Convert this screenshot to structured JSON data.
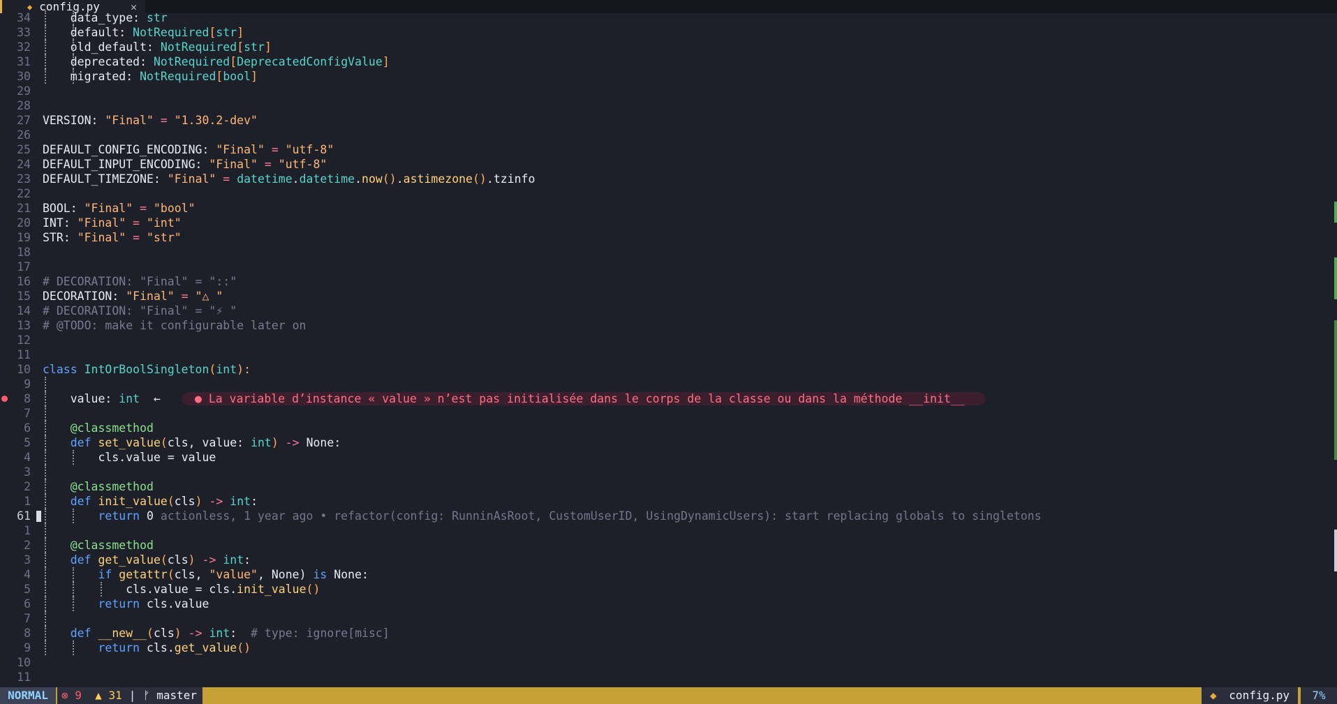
{
  "tab": {
    "filename": "config.py",
    "file_icon": "python-file-icon",
    "close_glyph": "✕"
  },
  "lines": [
    {
      "ln": "34",
      "code": [
        [
          "    ",
          "n"
        ],
        [
          "data_type",
          "n"
        ],
        [
          ": ",
          "n"
        ],
        [
          "str",
          "t"
        ]
      ],
      "guides": 2
    },
    {
      "ln": "33",
      "code": [
        [
          "    ",
          "n"
        ],
        [
          "default",
          "n"
        ],
        [
          ": ",
          "n"
        ],
        [
          "NotRequired",
          "t"
        ],
        [
          "[",
          "br"
        ],
        [
          "str",
          "t"
        ],
        [
          "]",
          "br"
        ]
      ],
      "guides": 2
    },
    {
      "ln": "32",
      "code": [
        [
          "    ",
          "n"
        ],
        [
          "old_default",
          "n"
        ],
        [
          ": ",
          "n"
        ],
        [
          "NotRequired",
          "t"
        ],
        [
          "[",
          "br"
        ],
        [
          "str",
          "t"
        ],
        [
          "]",
          "br"
        ]
      ],
      "guides": 2
    },
    {
      "ln": "31",
      "code": [
        [
          "    ",
          "n"
        ],
        [
          "deprecated",
          "n"
        ],
        [
          ": ",
          "n"
        ],
        [
          "NotRequired",
          "t"
        ],
        [
          "[",
          "br"
        ],
        [
          "DeprecatedConfigValue",
          "t"
        ],
        [
          "]",
          "br"
        ]
      ],
      "guides": 2
    },
    {
      "ln": "30",
      "code": [
        [
          "    ",
          "n"
        ],
        [
          "migrated",
          "n"
        ],
        [
          ": ",
          "n"
        ],
        [
          "NotRequired",
          "t"
        ],
        [
          "[",
          "br"
        ],
        [
          "bool",
          "t"
        ],
        [
          "]",
          "br"
        ]
      ],
      "guides": 2
    },
    {
      "ln": "29",
      "code": []
    },
    {
      "ln": "28",
      "code": []
    },
    {
      "ln": "27",
      "code": [
        [
          "VERSION",
          "n"
        ],
        [
          ": ",
          "n"
        ],
        [
          "\"Final\"",
          "s"
        ],
        [
          " = ",
          "op"
        ],
        [
          "\"1.30.2-dev\"",
          "s"
        ]
      ]
    },
    {
      "ln": "26",
      "code": []
    },
    {
      "ln": "25",
      "code": [
        [
          "DEFAULT_CONFIG_ENCODING",
          "n"
        ],
        [
          ": ",
          "n"
        ],
        [
          "\"Final\"",
          "s"
        ],
        [
          " = ",
          "op"
        ],
        [
          "\"utf-8\"",
          "s"
        ]
      ]
    },
    {
      "ln": "24",
      "code": [
        [
          "DEFAULT_INPUT_ENCODING",
          "n"
        ],
        [
          ": ",
          "n"
        ],
        [
          "\"Final\"",
          "s"
        ],
        [
          " = ",
          "op"
        ],
        [
          "\"utf-8\"",
          "s"
        ]
      ]
    },
    {
      "ln": "23",
      "code": [
        [
          "DEFAULT_TIMEZONE",
          "n"
        ],
        [
          ": ",
          "n"
        ],
        [
          "\"Final\"",
          "s"
        ],
        [
          " = ",
          "op"
        ],
        [
          "datetime",
          "t"
        ],
        [
          ".",
          "n"
        ],
        [
          "datetime",
          "t"
        ],
        [
          ".",
          "n"
        ],
        [
          "now",
          "f"
        ],
        [
          "()",
          "br"
        ],
        [
          ".",
          "n"
        ],
        [
          "astimezone",
          "f"
        ],
        [
          "()",
          "br"
        ],
        [
          ".",
          "n"
        ],
        [
          "tzinfo",
          "n"
        ]
      ]
    },
    {
      "ln": "22",
      "code": []
    },
    {
      "ln": "21",
      "code": [
        [
          "BOOL",
          "n"
        ],
        [
          ": ",
          "n"
        ],
        [
          "\"Final\"",
          "s"
        ],
        [
          " = ",
          "op"
        ],
        [
          "\"bool\"",
          "s"
        ]
      ]
    },
    {
      "ln": "20",
      "code": [
        [
          "INT",
          "n"
        ],
        [
          ": ",
          "n"
        ],
        [
          "\"Final\"",
          "s"
        ],
        [
          " = ",
          "op"
        ],
        [
          "\"int\"",
          "s"
        ]
      ]
    },
    {
      "ln": "19",
      "code": [
        [
          "STR",
          "n"
        ],
        [
          ": ",
          "n"
        ],
        [
          "\"Final\"",
          "s"
        ],
        [
          " = ",
          "op"
        ],
        [
          "\"str\"",
          "s"
        ]
      ]
    },
    {
      "ln": "18",
      "code": []
    },
    {
      "ln": "17",
      "code": []
    },
    {
      "ln": "16",
      "code": [
        [
          "# DECORATION: \"Final\" = \"::\"",
          "c"
        ]
      ]
    },
    {
      "ln": "15",
      "code": [
        [
          "DECORATION",
          "n"
        ],
        [
          ": ",
          "n"
        ],
        [
          "\"Final\"",
          "s"
        ],
        [
          " = ",
          "op"
        ],
        [
          "\"△ \"",
          "s"
        ]
      ]
    },
    {
      "ln": "14",
      "code": [
        [
          "# DECORATION: \"Final\" = \"⚡ \"",
          "c"
        ]
      ]
    },
    {
      "ln": "13",
      "code": [
        [
          "# @TODO: make it configurable later on",
          "c"
        ]
      ]
    },
    {
      "ln": "12",
      "code": []
    },
    {
      "ln": "11",
      "code": []
    },
    {
      "ln": "10",
      "code": [
        [
          "class ",
          "k"
        ],
        [
          "IntOrBoolSingleton",
          "t"
        ],
        [
          "(",
          "br"
        ],
        [
          "int",
          "t"
        ],
        [
          "):",
          "br"
        ]
      ]
    },
    {
      "ln": "9",
      "code": [],
      "guides": 1
    },
    {
      "ln": "8",
      "code": [
        [
          "    ",
          "n"
        ],
        [
          "value",
          "n"
        ],
        [
          ": ",
          "n"
        ],
        [
          "int",
          "t"
        ],
        [
          "  ←",
          "n"
        ]
      ],
      "guides": 1,
      "error": true,
      "diagnostic": "● La variable d’instance « value » n’est pas initialisée dans le corps de la classe ou dans la méthode __init__"
    },
    {
      "ln": "7",
      "code": [],
      "guides": 1
    },
    {
      "ln": "6",
      "code": [
        [
          "    ",
          "n"
        ],
        [
          "@classmethod",
          "d"
        ]
      ],
      "guides": 1
    },
    {
      "ln": "5",
      "code": [
        [
          "    ",
          "n"
        ],
        [
          "def ",
          "k"
        ],
        [
          "set_value",
          "f"
        ],
        [
          "(",
          "br"
        ],
        [
          "cls, value: ",
          "n"
        ],
        [
          "int",
          "t"
        ],
        [
          ") ",
          "br"
        ],
        [
          "-> ",
          "op"
        ],
        [
          "None",
          "n"
        ],
        [
          ":",
          "n"
        ]
      ],
      "guides": 1
    },
    {
      "ln": "4",
      "code": [
        [
          "        ",
          "n"
        ],
        [
          "cls.value = value",
          "n"
        ]
      ],
      "guides": 2
    },
    {
      "ln": "3",
      "code": [],
      "guides": 1
    },
    {
      "ln": "2",
      "code": [
        [
          "    ",
          "n"
        ],
        [
          "@classmethod",
          "d"
        ]
      ],
      "guides": 1
    },
    {
      "ln": "1",
      "code": [
        [
          "    ",
          "n"
        ],
        [
          "def ",
          "k"
        ],
        [
          "init_value",
          "f"
        ],
        [
          "(",
          "br"
        ],
        [
          "cls",
          "n"
        ],
        [
          ") ",
          "br"
        ],
        [
          "-> ",
          "op"
        ],
        [
          "int",
          "t"
        ],
        [
          ":",
          "n"
        ]
      ],
      "guides": 1
    },
    {
      "ln": "61",
      "current": true,
      "code": [
        [
          "        ",
          "n"
        ],
        [
          "return ",
          "k"
        ],
        [
          "0",
          "n"
        ],
        [
          " actionless, 1 year ago • refactor(config: RunninAsRoot, CustomUserID, UsingDynamicUsers): start replacing globals to singletons",
          "blame"
        ]
      ],
      "guides": 2
    },
    {
      "ln": "1",
      "code": [],
      "guides": 1
    },
    {
      "ln": "2",
      "code": [
        [
          "    ",
          "n"
        ],
        [
          "@classmethod",
          "d"
        ]
      ],
      "guides": 1
    },
    {
      "ln": "3",
      "code": [
        [
          "    ",
          "n"
        ],
        [
          "def ",
          "k"
        ],
        [
          "get_value",
          "f"
        ],
        [
          "(",
          "br"
        ],
        [
          "cls",
          "n"
        ],
        [
          ") ",
          "br"
        ],
        [
          "-> ",
          "op"
        ],
        [
          "int",
          "t"
        ],
        [
          ":",
          "n"
        ]
      ],
      "guides": 1
    },
    {
      "ln": "4",
      "code": [
        [
          "        ",
          "n"
        ],
        [
          "if ",
          "k"
        ],
        [
          "getattr",
          "f"
        ],
        [
          "(",
          "br"
        ],
        [
          "cls, ",
          "n"
        ],
        [
          "\"value\"",
          "s"
        ],
        [
          ", None) ",
          "n"
        ],
        [
          "is ",
          "k"
        ],
        [
          "None",
          "n"
        ],
        [
          ":",
          "n"
        ]
      ],
      "guides": 2
    },
    {
      "ln": "5",
      "code": [
        [
          "            ",
          "n"
        ],
        [
          "cls.value = cls.",
          "n"
        ],
        [
          "init_value",
          "f"
        ],
        [
          "()",
          "br"
        ]
      ],
      "guides": 3
    },
    {
      "ln": "6",
      "code": [
        [
          "        ",
          "n"
        ],
        [
          "return ",
          "k"
        ],
        [
          "cls.value",
          "n"
        ]
      ],
      "guides": 2
    },
    {
      "ln": "7",
      "code": [],
      "guides": 1
    },
    {
      "ln": "8",
      "code": [
        [
          "    ",
          "n"
        ],
        [
          "def ",
          "k"
        ],
        [
          "__new__",
          "f"
        ],
        [
          "(",
          "br"
        ],
        [
          "cls",
          "n"
        ],
        [
          ") ",
          "br"
        ],
        [
          "-> ",
          "op"
        ],
        [
          "int",
          "t"
        ],
        [
          ":  ",
          "n"
        ],
        [
          "# type: ignore[misc]",
          "c"
        ]
      ],
      "guides": 1
    },
    {
      "ln": "9",
      "code": [
        [
          "        ",
          "n"
        ],
        [
          "return ",
          "k"
        ],
        [
          "cls.",
          "n"
        ],
        [
          "get_value",
          "f"
        ],
        [
          "()",
          "br"
        ]
      ],
      "guides": 2
    },
    {
      "ln": "10",
      "code": []
    },
    {
      "ln": "11",
      "code": []
    }
  ],
  "status": {
    "mode": "NORMAL",
    "errors_icon": "error-circle-icon",
    "errors": "9",
    "warnings_icon": "warning-triangle-icon",
    "warnings": "31",
    "separator": "|",
    "branch_icon": "git-branch-icon",
    "branch": "master",
    "file": "config.py",
    "percent": "7%"
  },
  "colors": {
    "background": "#1d1f29",
    "statusbar": "#c5a135",
    "error": "#ff5c6c",
    "warning": "#ffcc55"
  }
}
